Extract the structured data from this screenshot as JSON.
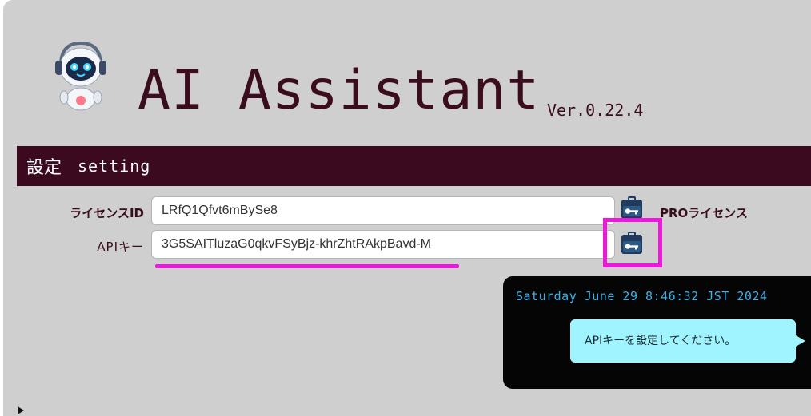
{
  "app": {
    "title": "AI Assistant",
    "version": "Ver.0.22.4"
  },
  "section": {
    "title_jp": "設定",
    "title_en": "setting"
  },
  "form": {
    "license": {
      "label": "ライセンスID",
      "value": "LRfQ1Qfvt6mBySe8",
      "icon": "key-card-icon"
    },
    "api": {
      "label": "APIキー",
      "value": "3G5SAITluzaG0qkvFSyBjz-khrZhtRAkpBavd-M",
      "icon": "key-card-icon"
    },
    "pro_label": "PROライセンス"
  },
  "notification": {
    "datetime": "Saturday June 29 8:46:32 JST 2024",
    "message": "APIキーを設定してください。"
  },
  "colors": {
    "background": "#cfcfcf",
    "accent": "#3c0a1f",
    "highlight": "#ee18dd",
    "datetime": "#39b4ea",
    "bubble": "#9ff4ff"
  }
}
